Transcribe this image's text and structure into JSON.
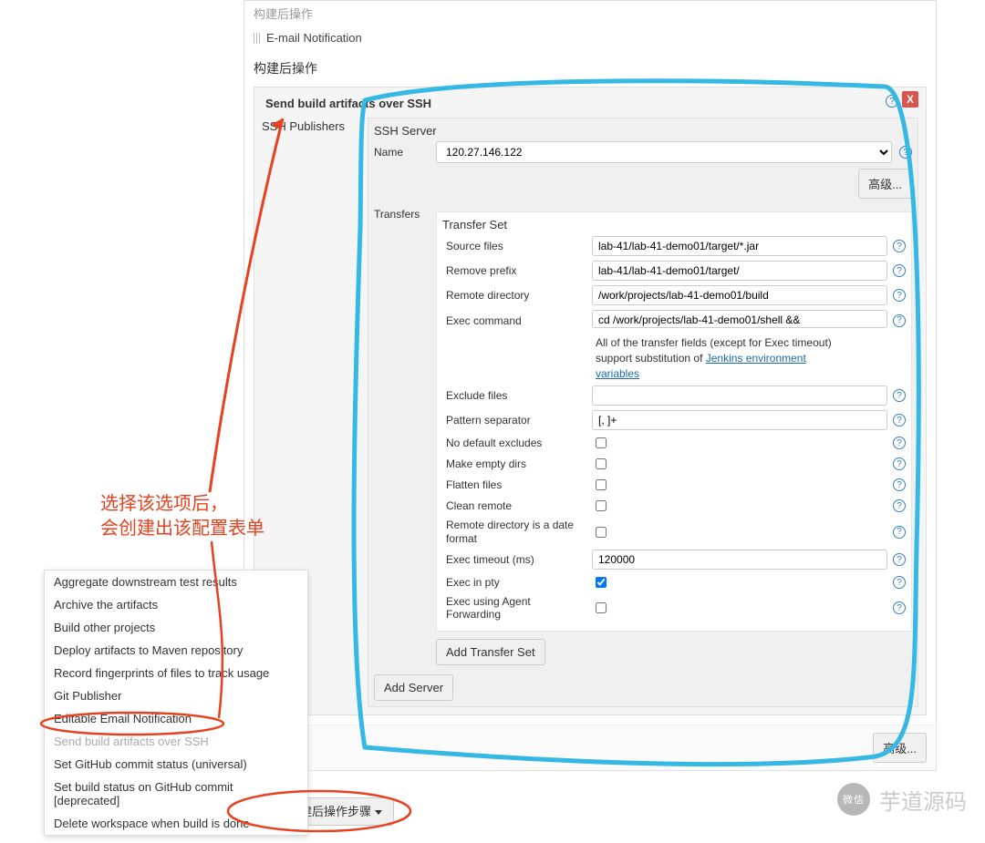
{
  "top": {
    "muted_label": "构建后操作",
    "email_checkbox_label": "E-mail Notification"
  },
  "section_title": "构建后操作",
  "close_x": "X",
  "block_title": "Send build artifacts over SSH",
  "publishers_label": "SSH Publishers",
  "server": {
    "title": "SSH Server",
    "name_label": "Name",
    "name_value": "120.27.146.122",
    "advanced_btn": "高级..."
  },
  "transfers": {
    "label": "Transfers",
    "set_title": "Transfer Set",
    "source_files_label": "Source files",
    "source_files": "lab-41/lab-41-demo01/target/*.jar",
    "remove_prefix_label": "Remove prefix",
    "remove_prefix": "lab-41/lab-41-demo01/target/",
    "remote_dir_label": "Remote directory",
    "remote_dir": "/work/projects/lab-41-demo01/build",
    "exec_cmd_label": "Exec command",
    "exec_cmd": "cd /work/projects/lab-41-demo01/shell &&",
    "note_prefix": "All of the transfer fields (except for Exec timeout) support substitution of ",
    "note_link": "Jenkins environment variables",
    "exclude_label": "Exclude files",
    "exclude": "",
    "pattern_label": "Pattern separator",
    "pattern": "[, ]+",
    "no_default_excludes_label": "No default excludes",
    "make_empty_label": "Make empty dirs",
    "flatten_label": "Flatten files",
    "clean_remote_label": "Clean remote",
    "remote_date_label": "Remote directory is a date format",
    "exec_timeout_label": "Exec timeout (ms)",
    "exec_timeout": "120000",
    "exec_pty_label": "Exec in pty",
    "exec_agent_fwd_label": "Exec using Agent Forwarding",
    "add_transfer_btn": "Add Transfer Set"
  },
  "add_server_btn": "Add Server",
  "advanced_outer": "高级...",
  "add_step_btn": "增加构建后操作步骤",
  "dropdown_items": [
    "Aggregate downstream test results",
    "Archive the artifacts",
    "Build other projects",
    "Deploy artifacts to Maven repository",
    "Record fingerprints of files to track usage",
    "Git Publisher",
    "Editable Email Notification",
    "Send build artifacts over SSH",
    "Set GitHub commit status (universal)",
    "Set build status on GitHub commit [deprecated]",
    "Delete workspace when build is done"
  ],
  "dropdown_disabled_index": 7,
  "annotation": "选择该选项后，\n会创建出该配置表单",
  "watermark": {
    "icon": "微信",
    "text": "芋道源码"
  }
}
